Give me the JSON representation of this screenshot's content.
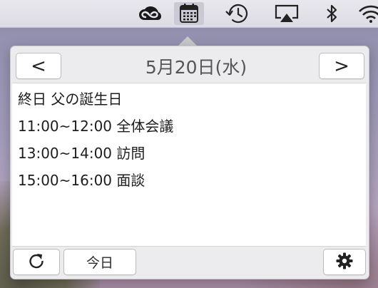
{
  "menubar": {
    "icons": [
      {
        "name": "creative-cloud-icon"
      },
      {
        "name": "calendar-icon"
      },
      {
        "name": "time-machine-icon"
      },
      {
        "name": "airplay-icon"
      },
      {
        "name": "bluetooth-icon"
      },
      {
        "name": "wifi-icon"
      }
    ]
  },
  "popover": {
    "prev_label": "<",
    "next_label": ">",
    "date_title": "5月20日(水)",
    "events": [
      {
        "text": "終日 父の誕生日"
      },
      {
        "text": "11:00~12:00 全体会議"
      },
      {
        "text": "13:00~14:00 訪問"
      },
      {
        "text": "15:00~16:00 面談"
      }
    ],
    "footer": {
      "refresh_icon": "refresh-icon",
      "today_label": "今日",
      "settings_icon": "gear-icon"
    }
  }
}
